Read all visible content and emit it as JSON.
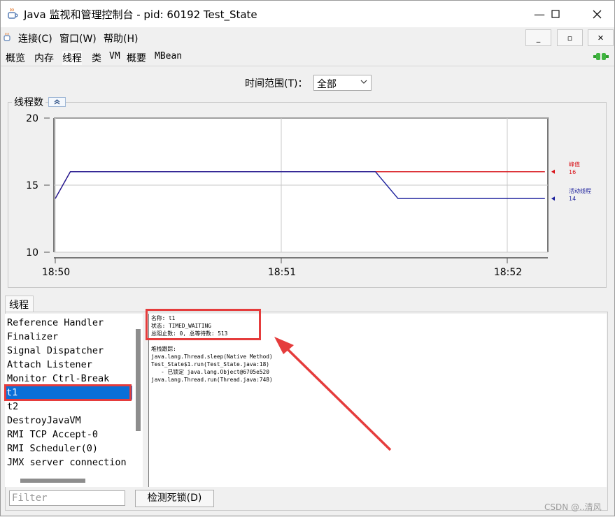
{
  "window": {
    "title": "Java 监视和管理控制台 - pid: 60192 Test_State",
    "controls": {
      "minimize": "—",
      "maximize": "☐",
      "close": "✕"
    }
  },
  "menu": {
    "items": [
      "连接(C)",
      "窗口(W)",
      "帮助(H)"
    ],
    "mdi_buttons": [
      "_",
      "▫",
      "✕"
    ]
  },
  "tabs": [
    "概览",
    "内存",
    "线程",
    "类",
    "VM",
    "概要",
    "MBean"
  ],
  "active_tab": "线程",
  "time_range": {
    "label": "时间范围(T)：",
    "value": "全部"
  },
  "thread_chart_panel": {
    "title": "线程数"
  },
  "chart_data": {
    "type": "line",
    "title": "线程数",
    "x_ticks": [
      "18:50",
      "18:51",
      "18:52"
    ],
    "ylim": [
      10,
      20
    ],
    "y_ticks": [
      "10",
      "15",
      "20"
    ],
    "series": [
      {
        "name": "峰值",
        "color": "#d8141a",
        "current": "16",
        "points": [
          [
            "18:50:00",
            14
          ],
          [
            "18:50:04",
            16
          ],
          [
            "18:51:25",
            16
          ],
          [
            "18:52:10",
            16
          ]
        ]
      },
      {
        "name": "活动线程",
        "color": "#1b1f9c",
        "current": "14",
        "points": [
          [
            "18:50:00",
            14
          ],
          [
            "18:50:04",
            16
          ],
          [
            "18:51:25",
            16
          ],
          [
            "18:51:31",
            14
          ],
          [
            "18:52:10",
            14
          ]
        ]
      }
    ]
  },
  "threads": {
    "tab_label": "线程",
    "list": [
      "Reference Handler",
      "Finalizer",
      "Signal Dispatcher",
      "Attach Listener",
      "Monitor Ctrl-Break",
      "t1",
      "t2",
      "DestroyJavaVM",
      "RMI TCP Accept-0",
      "RMI Scheduler(0)",
      "JMX server connection"
    ],
    "selected": "t1",
    "detail_lines": [
      "名称: t1",
      "状态: TIMED_WAITING",
      "总阻止数: 0, 总等待数: 513",
      "",
      "堆栈跟踪:",
      "java.lang.Thread.sleep(Native Method)",
      "Test_State$1.run(Test_State.java:18)",
      "   - 已锁定 java.lang.Object@6705e520",
      "java.lang.Thread.run(Thread.java:748)"
    ],
    "filter_placeholder": "Filter",
    "deadlock_button": "检测死锁(D)"
  },
  "watermark": "CSDN @..清风",
  "colors": {
    "selection": "#0a6fd8",
    "annotation": "#e53c3c",
    "peak": "#d8141a",
    "live": "#1b1f9c"
  }
}
